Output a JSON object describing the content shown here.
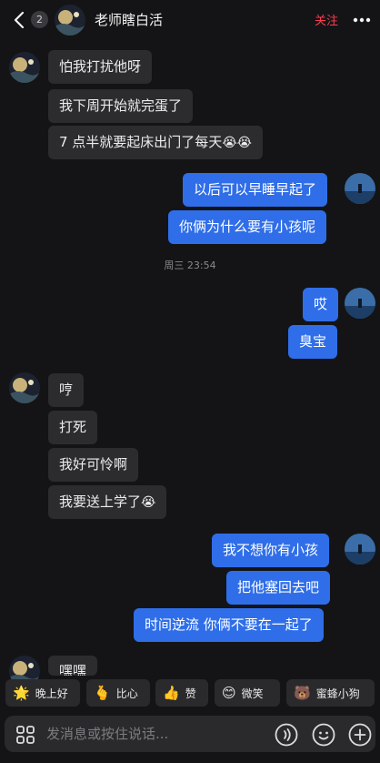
{
  "header": {
    "unread_count": "2",
    "title": "老师瞎白活",
    "follow_label": "关注"
  },
  "messages": [
    {
      "side": "in",
      "text": "怕我打扰他呀"
    },
    {
      "side": "in",
      "text": "我下周开始就完蛋了"
    },
    {
      "side": "in",
      "text": "7 点半就要起床出门了每天",
      "emoji": "😭😭"
    },
    {
      "side": "out",
      "text": "以后可以早睡早起了"
    },
    {
      "side": "out",
      "text": "你俩为什么要有小孩呢"
    },
    {
      "side": "out",
      "text": "哎"
    },
    {
      "side": "out",
      "text": "臭宝"
    },
    {
      "side": "in",
      "text": "哼"
    },
    {
      "side": "in",
      "text": "打死"
    },
    {
      "side": "in",
      "text": "我好可怜啊"
    },
    {
      "side": "in",
      "text": "我要送上学了",
      "emoji": "😭"
    },
    {
      "side": "out",
      "text": "我不想你有小孩"
    },
    {
      "side": "out",
      "text": "把他塞回去吧"
    },
    {
      "side": "out",
      "text": "时间逆流 你俩不要在一起了"
    },
    {
      "side": "in",
      "text": "嘿嘿"
    }
  ],
  "timestamp": "周三 23:54",
  "quick_replies": [
    {
      "icon": "🌟",
      "label": "晚上好"
    },
    {
      "icon": "🫰",
      "label": "比心"
    },
    {
      "icon": "👍",
      "label": "赞"
    },
    {
      "icon": "😊",
      "label": "微笑"
    },
    {
      "icon": "🐻",
      "label": "蜜蜂小狗"
    }
  ],
  "input": {
    "placeholder": "发消息或按住说话..."
  },
  "colors": {
    "background": "#141416",
    "incoming_bubble": "#2c2c2f",
    "outgoing_bubble": "#2f6ee8",
    "follow": "#ff3b4f"
  },
  "icons": {
    "back": "chevron-left-icon",
    "more": "more-dots-icon",
    "grid": "grid-icon",
    "voice": "voice-icon",
    "emoji": "emoji-icon",
    "plus": "plus-icon"
  }
}
